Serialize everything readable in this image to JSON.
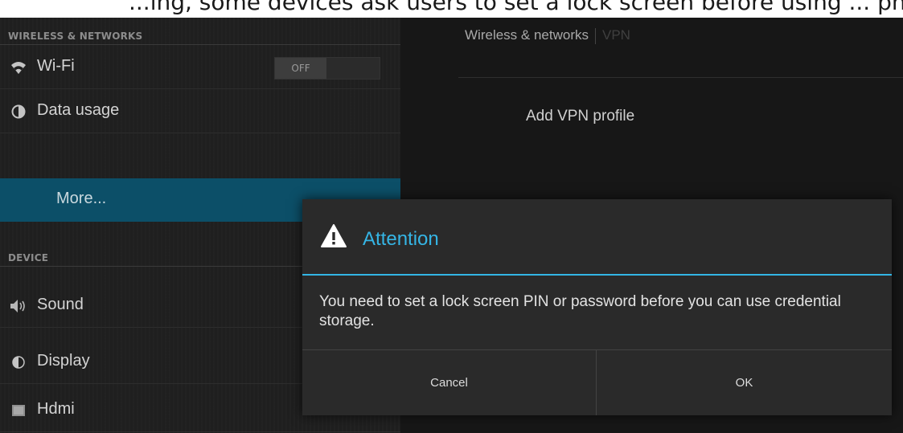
{
  "caption": {
    "text": "...ing, some devices ask users to set a lock screen before using ... phone)"
  },
  "settings": {
    "sections": {
      "wireless_header": "WIRELESS & NETWORKS",
      "device_header": "DEVICE"
    },
    "items": [
      {
        "id": "wifi",
        "label": "Wi-Fi",
        "icon": "wifi-icon"
      },
      {
        "id": "data_usage",
        "label": "Data usage",
        "icon": "data-usage-icon"
      },
      {
        "id": "more",
        "label": "More...",
        "selected": true
      },
      {
        "id": "sound",
        "label": "Sound",
        "icon": "speaker-icon"
      },
      {
        "id": "display",
        "label": "Display",
        "icon": "display-icon"
      },
      {
        "id": "hdmi",
        "label": "Hdmi",
        "icon": "hdmi-icon"
      }
    ],
    "wifi_toggle": {
      "state": "OFF"
    }
  },
  "detail": {
    "breadcrumb": [
      "Wireless & networks",
      "VPN"
    ],
    "add_vpn_label": "Add VPN profile"
  },
  "dialog": {
    "title": "Attention",
    "icon": "warning-icon",
    "message": "You need to set a lock screen PIN or password before you can use credential storage.",
    "buttons": {
      "cancel": "Cancel",
      "ok": "OK"
    }
  },
  "colors": {
    "accent": "#33b5e5",
    "selected_row": "#0c4f68",
    "dialog_bg": "#2a2a2a"
  }
}
